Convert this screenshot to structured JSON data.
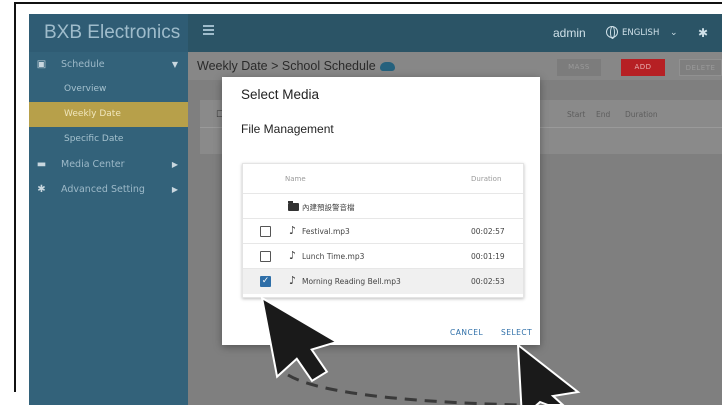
{
  "brand": "BXB Electronics",
  "sidebar": {
    "items": [
      {
        "label": "Schedule",
        "icon": "calendar-icon",
        "expanded": true
      },
      {
        "label": "Overview"
      },
      {
        "label": "Weekly Date",
        "active": true
      },
      {
        "label": "Specific Date"
      },
      {
        "label": "Media Center",
        "icon": "folder-icon"
      },
      {
        "label": "Advanced Setting",
        "icon": "gear-icon"
      }
    ]
  },
  "topbar": {
    "user": "admin",
    "language": "ENGLISH"
  },
  "breadcrumb": "Weekly Date > School Schedule",
  "toolbar": {
    "mass_label": "MASS",
    "add_label": "ADD",
    "delete_label": "DELETE"
  },
  "schedule_table": {
    "columns": [
      "Start",
      "End",
      "Duration"
    ]
  },
  "dialog": {
    "title": "Select Media",
    "subtitle": "File Management",
    "columns": {
      "name": "Name",
      "duration": "Duration"
    },
    "rows": [
      {
        "type": "folder",
        "name": "內建預設警音檔",
        "duration": "",
        "checked": false
      },
      {
        "type": "file",
        "name": "Festival.mp3",
        "duration": "00:02:57",
        "checked": false
      },
      {
        "type": "file",
        "name": "Lunch Time.mp3",
        "duration": "00:01:19",
        "checked": false
      },
      {
        "type": "file",
        "name": "Morning Reading Bell.mp3",
        "duration": "00:02:53",
        "checked": true
      }
    ],
    "cancel_label": "CANCEL",
    "select_label": "SELECT"
  },
  "colors": {
    "sidebar": "#33627a",
    "topbar": "#2b5466",
    "active_item": "#b7a04a",
    "add_button": "#b62024",
    "accent": "#2f6fa8"
  }
}
